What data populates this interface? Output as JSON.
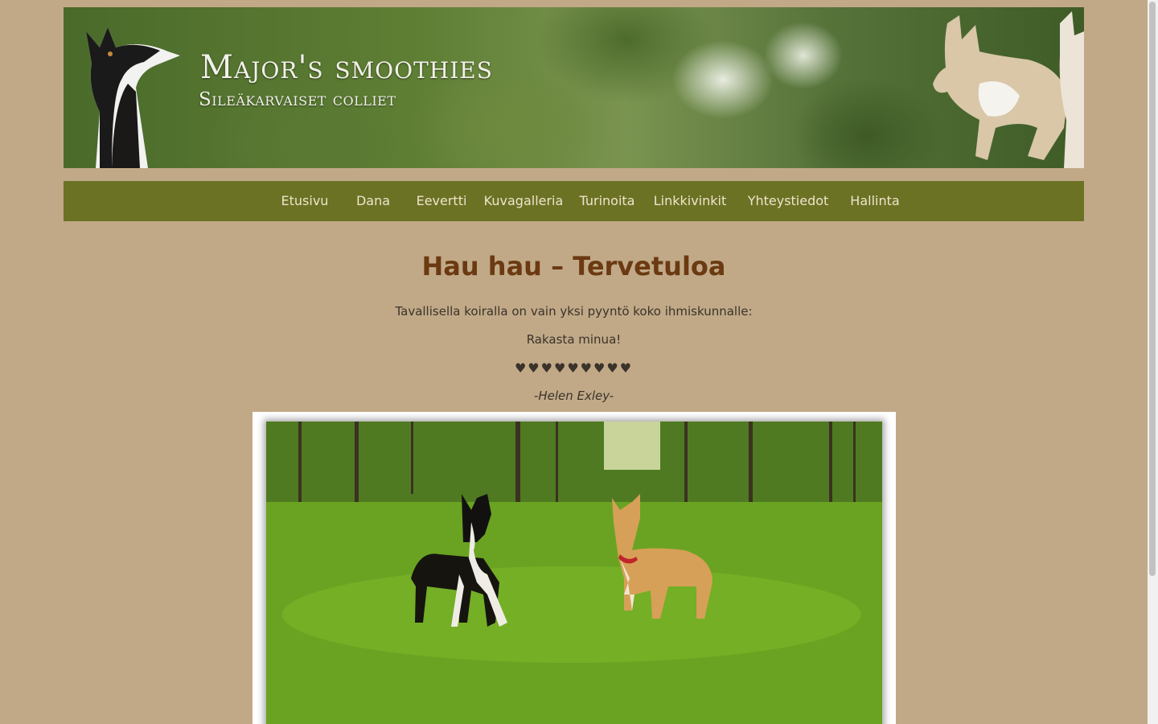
{
  "header": {
    "title": "Major's smoothies",
    "subtitle": "Sileäkarvaiset colliet"
  },
  "nav": {
    "items": [
      {
        "label": "Etusivu"
      },
      {
        "label": "Dana"
      },
      {
        "label": "Eevertti"
      },
      {
        "label": "Kuvagalleria"
      },
      {
        "label": "Turinoita"
      },
      {
        "label": "Linkkivinkit"
      },
      {
        "label": "Yhteystiedot"
      },
      {
        "label": "Hallinta"
      }
    ]
  },
  "main": {
    "heading": "Hau hau – Tervetuloa",
    "quote_line1": "Tavallisella koiralla on vain yksi pyyntö koko ihmiskunnalle:",
    "quote_line2": "Rakasta minua!",
    "hearts": "♥♥♥♥♥♥♥♥♥",
    "author": "-Helen Exley-"
  },
  "colors": {
    "page_background": "#c1a987",
    "nav_background": "#6b7224",
    "nav_text": "#eee4cc",
    "heading": "#6b3a12"
  }
}
